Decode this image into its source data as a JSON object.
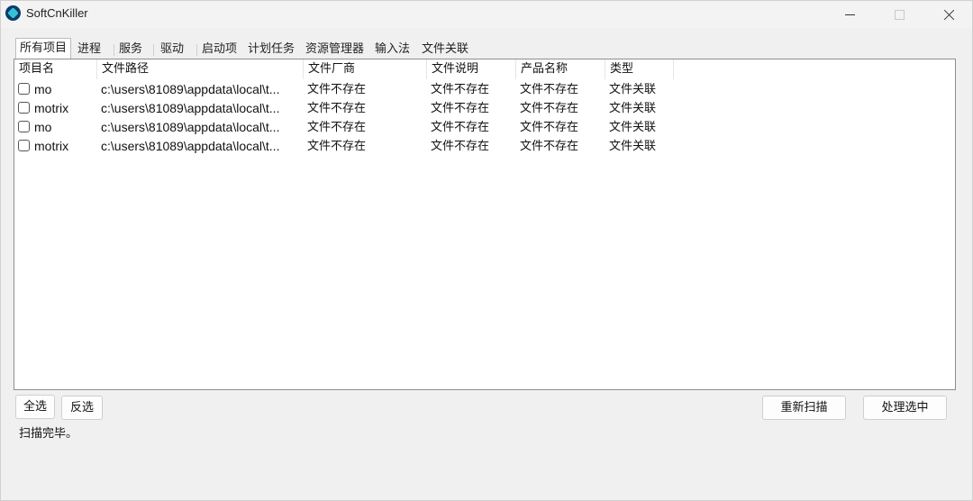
{
  "window": {
    "title": "SoftCnKiller"
  },
  "tabs": [
    "所有项目",
    "进程",
    "服务",
    "驱动",
    "启动项",
    "计划任务",
    "资源管理器",
    "输入法",
    "文件关联"
  ],
  "table": {
    "columns": [
      "项目名",
      "文件路径",
      "文件厂商",
      "文件说明",
      "产品名称",
      "类型"
    ],
    "rows": [
      {
        "name": "mo",
        "path": "c:\\users\\81089\\appdata\\local\\t...",
        "vendor": "文件不存在",
        "desc": "文件不存在",
        "product": "文件不存在",
        "type": "文件关联"
      },
      {
        "name": "motrix",
        "path": "c:\\users\\81089\\appdata\\local\\t...",
        "vendor": "文件不存在",
        "desc": "文件不存在",
        "product": "文件不存在",
        "type": "文件关联"
      },
      {
        "name": "mo",
        "path": "c:\\users\\81089\\appdata\\local\\t...",
        "vendor": "文件不存在",
        "desc": "文件不存在",
        "product": "文件不存在",
        "type": "文件关联"
      },
      {
        "name": "motrix",
        "path": "c:\\users\\81089\\appdata\\local\\t...",
        "vendor": "文件不存在",
        "desc": "文件不存在",
        "product": "文件不存在",
        "type": "文件关联"
      }
    ]
  },
  "buttons": {
    "select_all": "全选",
    "invert": "反选",
    "rescan": "重新扫描",
    "process": "处理选中"
  },
  "status": "扫描完毕。"
}
